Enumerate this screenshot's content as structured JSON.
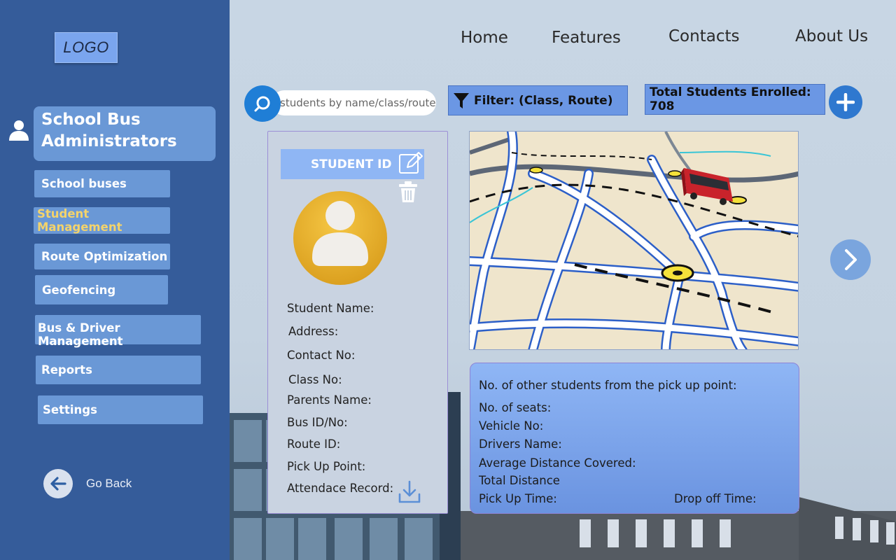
{
  "brand": {
    "logo": "LOGO"
  },
  "sidebar": {
    "title": "School Bus Administrators",
    "title_line1": "School Bus",
    "title_line2": "Administrators",
    "items": [
      {
        "label": "School buses"
      },
      {
        "label": "Student Management",
        "active": true
      },
      {
        "label": "Route Optimization"
      },
      {
        "label": "Geofencing"
      },
      {
        "label": "Bus & Driver Management"
      },
      {
        "label": "Reports"
      },
      {
        "label": "Settings"
      }
    ],
    "go_back": "Go Back"
  },
  "topnav": {
    "home": "Home",
    "features": "Features",
    "contacts": "Contacts",
    "about": "About Us"
  },
  "toolbar": {
    "search_placeholder": "students by name/class/route",
    "filter_label": "Filter: (Class, Route)",
    "total_label": "Total Students Enrolled: 708"
  },
  "student": {
    "id_button": "STUDENT ID",
    "fields": [
      "Student Name:",
      "Address:",
      "Contact No:",
      "Class No:",
      "Parents Name:",
      "Bus ID/No:",
      "Route ID:",
      "Pick Up Point:",
      "Attendace Record:"
    ]
  },
  "bus_info": {
    "fields": [
      "No. of other students from the pick up point:",
      "No. of seats:",
      "Vehicle No:",
      "Drivers Name:",
      "Average Distance Covered:",
      "Total Distance",
      "Pick Up Time:"
    ],
    "drop_off": "Drop off Time:"
  },
  "icons": {
    "search": "search-icon",
    "filter": "filter-icon",
    "add": "plus-icon",
    "edit": "edit-icon",
    "delete": "trash-icon",
    "download": "download-icon",
    "next": "chevron-right-icon",
    "back": "arrow-left-icon",
    "user": "user-icon"
  },
  "colors": {
    "sidebar": "#355c9a",
    "nav_item": "#6a98d6",
    "active_text": "#f3d36b",
    "accent": "#1f7ed6",
    "avatar": "#e8b22e"
  }
}
